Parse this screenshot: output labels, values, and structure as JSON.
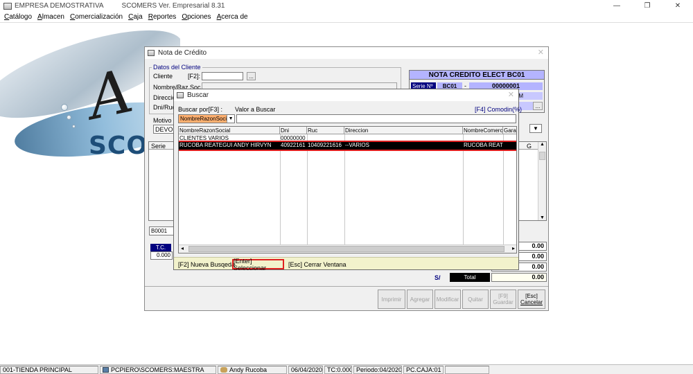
{
  "app": {
    "title": "EMPRESA DEMOSTRATIVA",
    "version": "SCOMERS Ver. Empresarial  8.31",
    "window_controls": [
      "—",
      "❐",
      "✕"
    ],
    "logo_text": "SCOM",
    "logo_letter": "A"
  },
  "menu": [
    "Catálogo",
    "Almacen",
    "Comercialización",
    "Caja",
    "Reportes",
    "Opciones",
    "Acerca de"
  ],
  "nota": {
    "title": "Nota de Crédito",
    "group_label": "Datos del Cliente",
    "cliente_label": "Cliente",
    "f2_label": "[F2]:",
    "nombre_label": "Nombre/Raz.Soc.",
    "direccion_label": "Direcció",
    "dni_label": "Dni/Ruc",
    "motivo_label": "Motivo d",
    "motivo_value": "DEVOL",
    "doc_title": "NOTA CREDITO ELECT BC01",
    "serie_label": "Serie Nº",
    "serie_value": "BC01",
    "dash": "-",
    "numero_value": "00000001",
    "time_fragment": "PM",
    "ellipsis": "...",
    "grid_header_serie": "Serie",
    "grid_header_g": "G",
    "combo_value": "B0001",
    "tc_label": "T.C.",
    "tc_value": "0.000",
    "currency_label": "S/",
    "total_label": "Total",
    "totals": [
      "0.00",
      "0.00",
      "0.00",
      "0.00"
    ],
    "buttons": {
      "imprimir": "Imprimir",
      "agregar": "Agregar",
      "modificar": "Modificar",
      "quitar": "Quitar",
      "guardar_key": "[F9]",
      "guardar": "Guardar",
      "cancelar_key": "[Esc]",
      "cancelar": "Cancelar"
    }
  },
  "buscar": {
    "title": "Buscar",
    "buscar_por_label": "Buscar por[F3] :",
    "valor_label": "Valor a Buscar",
    "comodin_label": "[F4] Comodin(%)",
    "field_selected": "NombreRazonSoci",
    "search_value": "",
    "columns": [
      "NombreRazonSocial",
      "Dni",
      "Ruc",
      "Direccion",
      "NombreComerci",
      "Gara"
    ],
    "rows": [
      [
        "CLIENTES VARIOS",
        "00000000",
        "",
        "",
        "",
        ""
      ],
      [
        "RUCOBA REATEGUI ANDY HIRVYN",
        "40922161",
        "10409221616",
        "--VARIOS",
        "RUCOBA REATE",
        ""
      ]
    ],
    "footer": {
      "nueva": "[F2] Nueva Busqeda",
      "seleccionar": "[Enter] Seleccionar",
      "cerrar": "[Esc] Cerrar Ventana"
    }
  },
  "status": {
    "tienda": "001-TIENDA PRINCIPAL",
    "db": "PCPIERO\\SCOMERS:MAESTRA",
    "user": "Andy Rucoba",
    "fecha": "06/04/2020",
    "tc": "TC:0.000",
    "periodo": "Periodo:04/2020",
    "caja": "PC.CAJA:01"
  },
  "colors": {
    "header_navy": "#00007f",
    "highlight_red": "#e02020",
    "selected_row": "#000000",
    "doc_header_blue": "#b4b4ff",
    "field_orange": "#ffb070",
    "footer_yellow": "#f2f2cc"
  }
}
